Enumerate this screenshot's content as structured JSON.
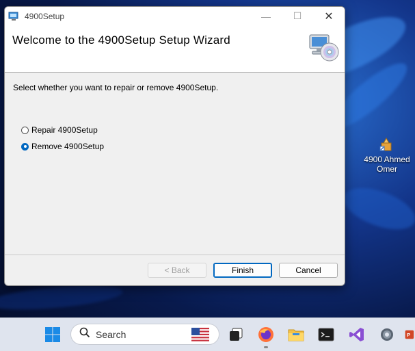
{
  "window": {
    "title": "4900Setup",
    "controls": {
      "minimize": "—",
      "maximize": "☐",
      "close": "✕"
    }
  },
  "banner": {
    "heading": "Welcome to the 4900Setup Setup Wizard",
    "icon": "computer-cd-icon"
  },
  "prompt": "Select whether you want to repair or remove 4900Setup.",
  "options": [
    {
      "label": "Repair 4900Setup",
      "selected": false
    },
    {
      "label": "Remove 4900Setup",
      "selected": true
    }
  ],
  "buttons": {
    "back": "< Back",
    "finish": "Finish",
    "cancel": "Cancel"
  },
  "desktop_icon": {
    "label_line1": "4900 Ahmed",
    "label_line2": "Omer"
  },
  "taskbar": {
    "search_placeholder": "Search",
    "apps": [
      "start-icon",
      "task-view-icon",
      "firefox-icon",
      "file-explorer-icon",
      "terminal-icon",
      "visual-studio-icon",
      "settings-icon",
      "powerpoint-icon"
    ]
  },
  "colors": {
    "accent": "#0067c0",
    "dialog_bg": "#f0f0f0"
  }
}
